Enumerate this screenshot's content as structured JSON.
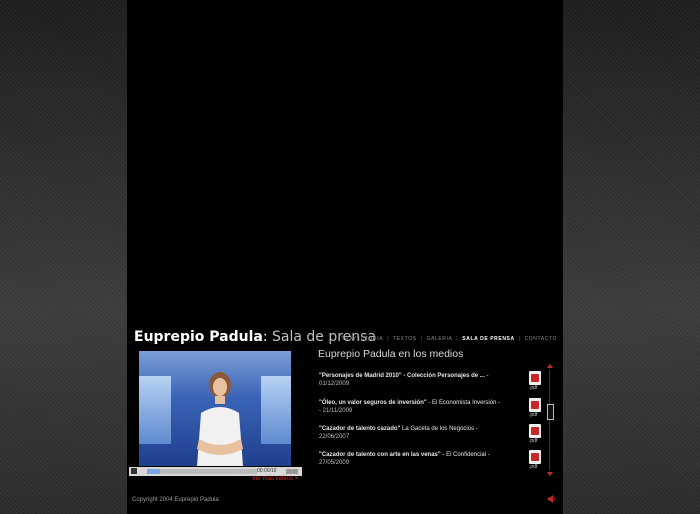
{
  "header": {
    "brand_name": "Euprepio Padula",
    "separator": ":",
    "section": "Sala de prensa"
  },
  "nav": {
    "items": [
      {
        "label": "TRAYECTORIA"
      },
      {
        "label": "TEXTOS"
      },
      {
        "label": "GALERIA"
      },
      {
        "label": "SALA DE PRENSA"
      },
      {
        "label": "CONTACTO"
      }
    ],
    "active": "SALA DE PRENSA"
  },
  "video": {
    "time": "00:00/10",
    "more_videos": "Ver más videos >",
    "progress_fraction": 0.12
  },
  "media": {
    "title": "Euprepio Padula en los medios",
    "items": [
      {
        "title": "\"Personajes de Madrid 2010\" - Colección Personajes de ...",
        "source": "-",
        "date": "01/12/2009",
        "file": ".pdf"
      },
      {
        "title": "\"Óleo, un valor seguros de inversión\"",
        "source": "- El Economista Inversión -",
        "date": "- 21/11/2009",
        "file": ".pdf"
      },
      {
        "title": "\"Cazador de talento cazado\" ",
        "source": "La Gaceta de los Negocios -",
        "date": "22/06/2007",
        "file": ".pdf"
      },
      {
        "title": "\"Cazador de talento con arte en las venas\"",
        "source": "- El Confidencial -",
        "date": "27/05/2009",
        "file": ".pdf"
      }
    ]
  },
  "footer": {
    "copyright": "Copyright 2004 Euprepio Padula"
  },
  "colors": {
    "accent": "#c0302a",
    "background": "#000000"
  }
}
